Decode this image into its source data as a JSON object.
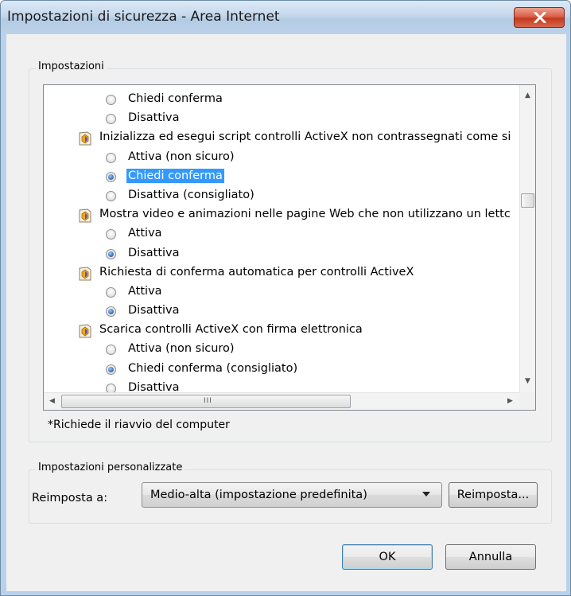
{
  "window": {
    "title": "Impostazioni di sicurezza - Area Internet",
    "close_icon": "close-icon"
  },
  "settings_group": {
    "legend": "Impostazioni",
    "rows": [
      {
        "type": "option",
        "label": "Chiedi conferma",
        "checked": false,
        "selected": false
      },
      {
        "type": "option",
        "label": "Disattiva",
        "checked": false,
        "selected": false
      },
      {
        "type": "category",
        "label": "Inizializza ed esegui script controlli ActiveX non contrassegnati come si",
        "icon": "activex-settings-icon"
      },
      {
        "type": "option",
        "label": "Attiva (non sicuro)",
        "checked": false,
        "selected": false
      },
      {
        "type": "option",
        "label": "Chiedi conferma",
        "checked": true,
        "selected": true
      },
      {
        "type": "option",
        "label": "Disattiva (consigliato)",
        "checked": false,
        "selected": false
      },
      {
        "type": "category",
        "label": "Mostra video e animazioni nelle pagine Web che non utilizzano un lettc",
        "icon": "activex-settings-icon"
      },
      {
        "type": "option",
        "label": "Attiva",
        "checked": false,
        "selected": false
      },
      {
        "type": "option",
        "label": "Disattiva",
        "checked": true,
        "selected": false
      },
      {
        "type": "category",
        "label": "Richiesta di conferma automatica per controlli ActiveX",
        "icon": "activex-settings-icon"
      },
      {
        "type": "option",
        "label": "Attiva",
        "checked": false,
        "selected": false
      },
      {
        "type": "option",
        "label": "Disattiva",
        "checked": true,
        "selected": false
      },
      {
        "type": "category",
        "label": "Scarica controlli ActiveX con firma elettronica",
        "icon": "activex-settings-icon"
      },
      {
        "type": "option",
        "label": "Attiva (non sicuro)",
        "checked": false,
        "selected": false
      },
      {
        "type": "option",
        "label": "Chiedi conferma (consigliato)",
        "checked": true,
        "selected": false
      },
      {
        "type": "option",
        "label": "Disattiva",
        "checked": false,
        "selected": false
      }
    ],
    "scroll_grip": "III",
    "restart_note": "*Richiede il riavvio del computer"
  },
  "custom_group": {
    "legend": "Impostazioni personalizzate",
    "reset_label": "Reimposta a:",
    "reset_level": "Medio-alta (impostazione predefinita)",
    "reset_button": "Reimposta..."
  },
  "footer": {
    "ok_label": "OK",
    "cancel_label": "Annulla"
  }
}
